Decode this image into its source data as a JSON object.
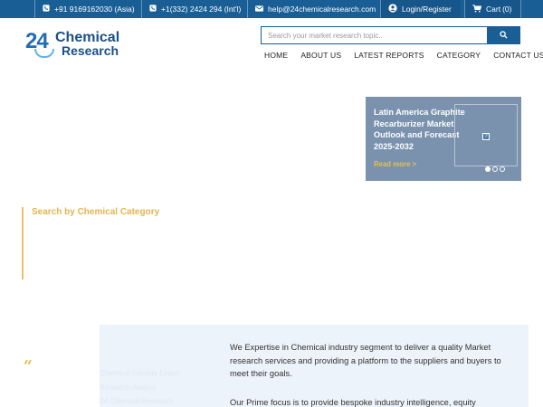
{
  "topbar": {
    "phone_asia": "+91 9169162030 (Asia)",
    "phone_intl": "+1(332) 2424 294 (Int'l)",
    "email": "help@24chemicalresearch.com",
    "login": "Login/Register",
    "cart_label": "Cart",
    "cart_count": "(0)"
  },
  "logo": {
    "number": "24",
    "line1": "Chemical",
    "line2": "Research"
  },
  "search": {
    "placeholder": "Search your market research topic.."
  },
  "nav": {
    "items": [
      "HOME",
      "ABOUT US",
      "LATEST REPORTS",
      "CATEGORY",
      "CONTACT US"
    ]
  },
  "slider": {
    "title": "Latin America Graphite Recarburizer Market Outlook and Forecast 2025-2032",
    "read_more": "Read more >",
    "image_placeholder": "?",
    "active_index": 0,
    "dot_count": 3
  },
  "category": {
    "title": "Search by Chemical Category"
  },
  "about": {
    "quote_mark": "“",
    "faint_lines": [
      "Chemical Industry Expert",
      "Research Analyst",
      "24 Chemical Research"
    ],
    "paragraph1": "We Expertise in Chemical industry segment to deliver a quality Market research services and providing a platform to the suppliers and buyers to meet their goals.",
    "paragraph2": "Our Prime focus is to provide bespoke industry intelligence, equity"
  },
  "colors": {
    "topbar": "#1a5e96",
    "accent_gold": "#e3b550",
    "slider_bg": "#7b92ae",
    "about_bg": "#edf3fa"
  }
}
